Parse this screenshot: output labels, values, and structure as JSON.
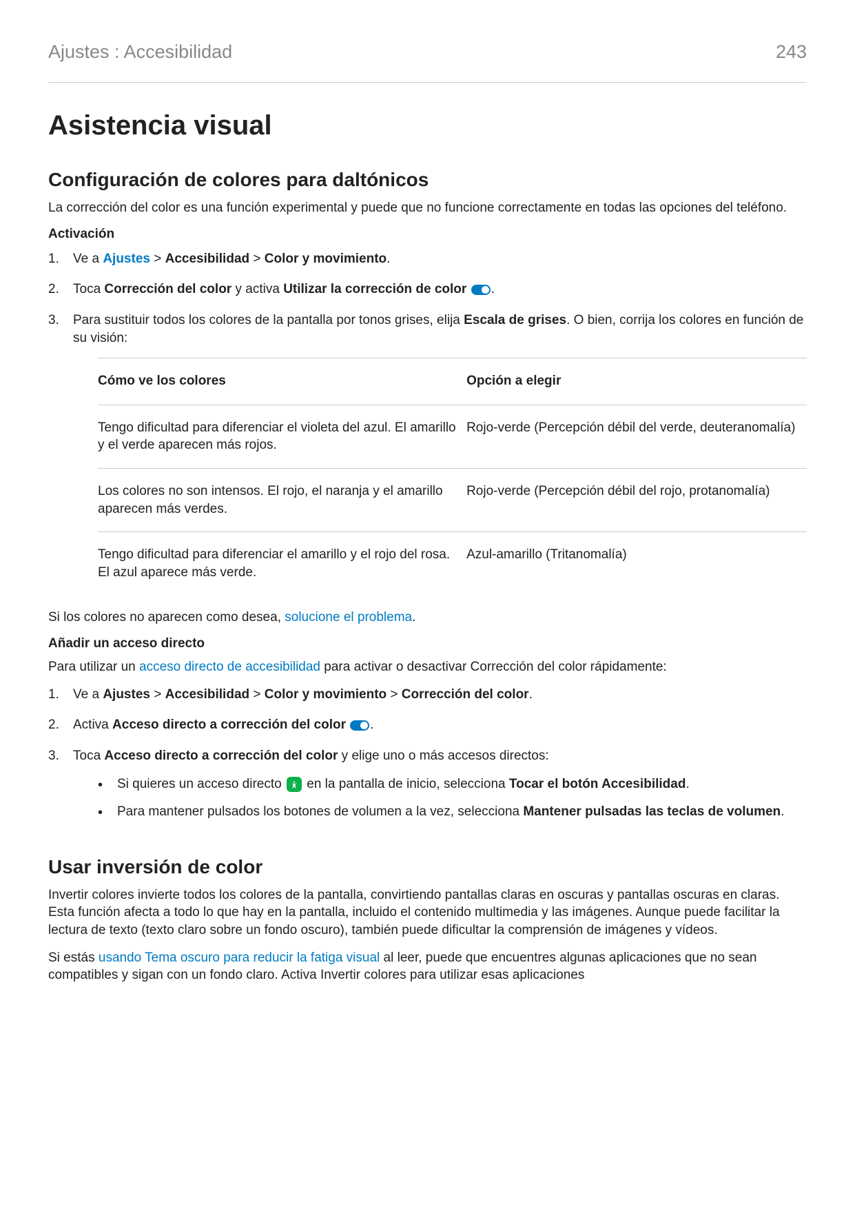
{
  "header": {
    "breadcrumb": "Ajustes : Accesibilidad",
    "page_number": "243"
  },
  "title": "Asistencia visual",
  "section1": {
    "heading": "Configuración de colores para daltónicos",
    "intro": "La corrección del color es una función experimental y puede que no funcione correctamente en todas las opciones del teléfono.",
    "activation_heading": "Activación",
    "step1": {
      "prefix": "Ve a ",
      "link": "Ajustes",
      "gt1": " > ",
      "bold1": "Accesibilidad",
      "gt2": " > ",
      "bold2": "Color y movimiento",
      "suffix": "."
    },
    "step2": {
      "prefix": "Toca ",
      "bold1": "Corrección del color",
      "mid": " y activa ",
      "bold2": "Utilizar la corrección de color",
      "suffix": "."
    },
    "step3": {
      "prefix": "Para sustituir todos los colores de la pantalla por tonos grises, elija ",
      "bold": "Escala de grises",
      "suffix": ". O bien, corrija los colores en función de su visión:"
    },
    "table": {
      "col1": "Cómo ve los colores",
      "col2": "Opción a elegir",
      "rows": [
        {
          "c1": "Tengo dificultad para diferenciar el violeta del azul. El amarillo y el verde aparecen más rojos.",
          "c2": "Rojo-verde (Percepción débil del verde, deuteranomalía)"
        },
        {
          "c1": "Los colores no son intensos. El rojo, el naranja y el amarillo aparecen más verdes.",
          "c2": "Rojo-verde (Percepción débil del rojo, protanomalía)"
        },
        {
          "c1": "Tengo dificultad para diferenciar el amarillo y el rojo del rosa. El azul aparece más verde.",
          "c2": "Azul-amarillo (Tritanomalía)"
        }
      ]
    },
    "post_table": {
      "prefix": "Si los colores no aparecen como desea, ",
      "link": "solucione el problema",
      "suffix": "."
    },
    "shortcut_heading": "Añadir un acceso directo",
    "shortcut_intro": {
      "prefix": "Para utilizar un ",
      "link": "acceso directo de accesibilidad",
      "suffix": " para activar o desactivar Corrección del color rápidamente:"
    },
    "sc_step1": {
      "prefix": "Ve a ",
      "b1": "Ajustes",
      "g1": " > ",
      "b2": "Accesibilidad",
      "g2": " > ",
      "b3": "Color y movimiento",
      "g3": " > ",
      "b4": "Corrección del color",
      "suffix": "."
    },
    "sc_step2": {
      "prefix": "Activa ",
      "b1": "Acceso directo a corrección del color",
      "suffix": "."
    },
    "sc_step3": {
      "prefix": "Toca ",
      "b1": "Acceso directo a corrección del color",
      "suffix": " y elige uno o más accesos directos:"
    },
    "sc_bullet1": {
      "prefix": "Si quieres un acceso directo ",
      "mid": " en la pantalla de inicio, selecciona ",
      "bold": "Tocar el botón Accesibilidad",
      "suffix": "."
    },
    "sc_bullet2": {
      "prefix": "Para mantener pulsados los botones de volumen a la vez, selecciona ",
      "bold": "Mantener pulsadas las teclas de volumen",
      "suffix": "."
    }
  },
  "section2": {
    "heading": "Usar inversión de color",
    "p1": "Invertir colores invierte todos los colores de la pantalla, convirtiendo pantallas claras en oscuras y pantallas oscuras en claras. Esta función afecta a todo lo que hay en la pantalla, incluido el contenido multimedia y las imágenes. Aunque puede facilitar la lectura de texto (texto claro sobre un fondo oscuro), también puede dificultar la comprensión de imágenes y vídeos.",
    "p2": {
      "prefix": "Si estás ",
      "link": "usando Tema oscuro para reducir la fatiga visual",
      "suffix": " al leer, puede que encuentres algunas aplicaciones que no sean compatibles y sigan con un fondo claro. Activa Invertir colores para utilizar esas aplicaciones"
    }
  }
}
